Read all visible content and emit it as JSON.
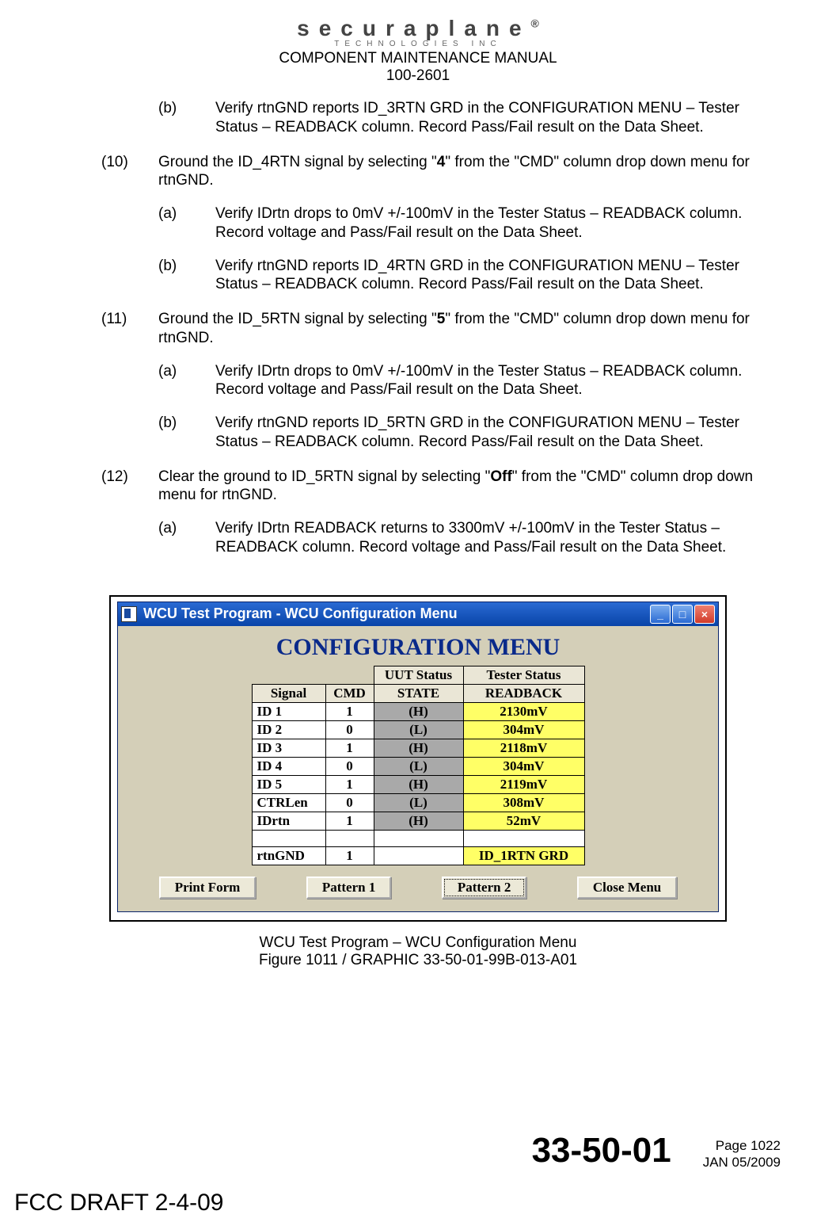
{
  "header": {
    "brand_main": "securaplane",
    "brand_reg": "®",
    "brand_sub": "TECHNOLOGIES INC",
    "title": "COMPONENT MAINTENANCE MANUAL",
    "doc_number": "100-2601"
  },
  "steps": {
    "pre_b": {
      "label": "(b)",
      "text": "Verify rtnGND reports ID_3RTN GRD in the CONFIGURATION MENU – Tester Status – READBACK column. Record Pass/Fail result on the Data Sheet."
    },
    "s10": {
      "label": "(10)",
      "text_a": "Ground the ID_4RTN signal by selecting \"",
      "bold": "4",
      "text_b": "\" from the \"CMD\" column drop down menu for rtnGND.",
      "a": {
        "label": "(a)",
        "text": "Verify IDrtn drops to 0mV +/-100mV in the Tester Status – READBACK column. Record voltage and Pass/Fail result on the Data Sheet."
      },
      "b": {
        "label": "(b)",
        "text": "Verify rtnGND reports ID_4RTN GRD in the CONFIGURATION MENU – Tester Status – READBACK column. Record Pass/Fail result on the Data Sheet."
      }
    },
    "s11": {
      "label": "(11)",
      "text_a": "Ground the ID_5RTN signal by selecting \"",
      "bold": "5",
      "text_b": "\" from the \"CMD\" column drop down menu for rtnGND.",
      "a": {
        "label": "(a)",
        "text": "Verify IDrtn drops to 0mV +/-100mV in the Tester Status – READBACK column. Record voltage and Pass/Fail result on the Data Sheet."
      },
      "b": {
        "label": "(b)",
        "text": "Verify rtnGND reports ID_5RTN GRD in the CONFIGURATION MENU – Tester Status – READBACK column. Record Pass/Fail result on the Data Sheet."
      }
    },
    "s12": {
      "label": "(12)",
      "text_a": "Clear the ground to ID_5RTN signal by selecting \"",
      "bold": "Off",
      "text_b": "\" from the \"CMD\" column drop down menu for rtnGND.",
      "a": {
        "label": "(a)",
        "text": "Verify IDrtn READBACK returns to 3300mV +/-100mV in the Tester Status – READBACK column. Record voltage and Pass/Fail result on the Data Sheet."
      }
    }
  },
  "window": {
    "title": "WCU Test Program - WCU Configuration Menu",
    "menu_title": "CONFIGURATION MENU",
    "group_uut": "UUT Status",
    "group_tester": "Tester Status",
    "col_signal": "Signal",
    "col_cmd": "CMD",
    "col_state": "STATE",
    "col_readback": "READBACK",
    "rows": [
      {
        "signal": "ID 1",
        "cmd": "1",
        "state": "(H)",
        "readback": "2130mV"
      },
      {
        "signal": "ID 2",
        "cmd": "0",
        "state": "(L)",
        "readback": "304mV"
      },
      {
        "signal": "ID 3",
        "cmd": "1",
        "state": "(H)",
        "readback": "2118mV"
      },
      {
        "signal": "ID 4",
        "cmd": "0",
        "state": "(L)",
        "readback": "304mV"
      },
      {
        "signal": "ID 5",
        "cmd": "1",
        "state": "(H)",
        "readback": "2119mV"
      },
      {
        "signal": "CTRLen",
        "cmd": "0",
        "state": "(L)",
        "readback": "308mV"
      },
      {
        "signal": "IDrtn",
        "cmd": "1",
        "state": "(H)",
        "readback": "52mV"
      }
    ],
    "row_rtn": {
      "signal": "rtnGND",
      "cmd": "1",
      "state": "",
      "readback": "ID_1RTN GRD"
    },
    "buttons": {
      "print": "Print Form",
      "pattern1": "Pattern 1",
      "pattern2": "Pattern 2",
      "close": "Close Menu"
    }
  },
  "figure": {
    "line1": "WCU Test Program – WCU Configuration Menu",
    "line2": "Figure 1011 / GRAPHIC 33-50-01-99B-013-A01"
  },
  "footer": {
    "section": "33-50-01",
    "page": "Page 1022",
    "date": "JAN 05/2009"
  },
  "fcc": "FCC DRAFT 2-4-09"
}
